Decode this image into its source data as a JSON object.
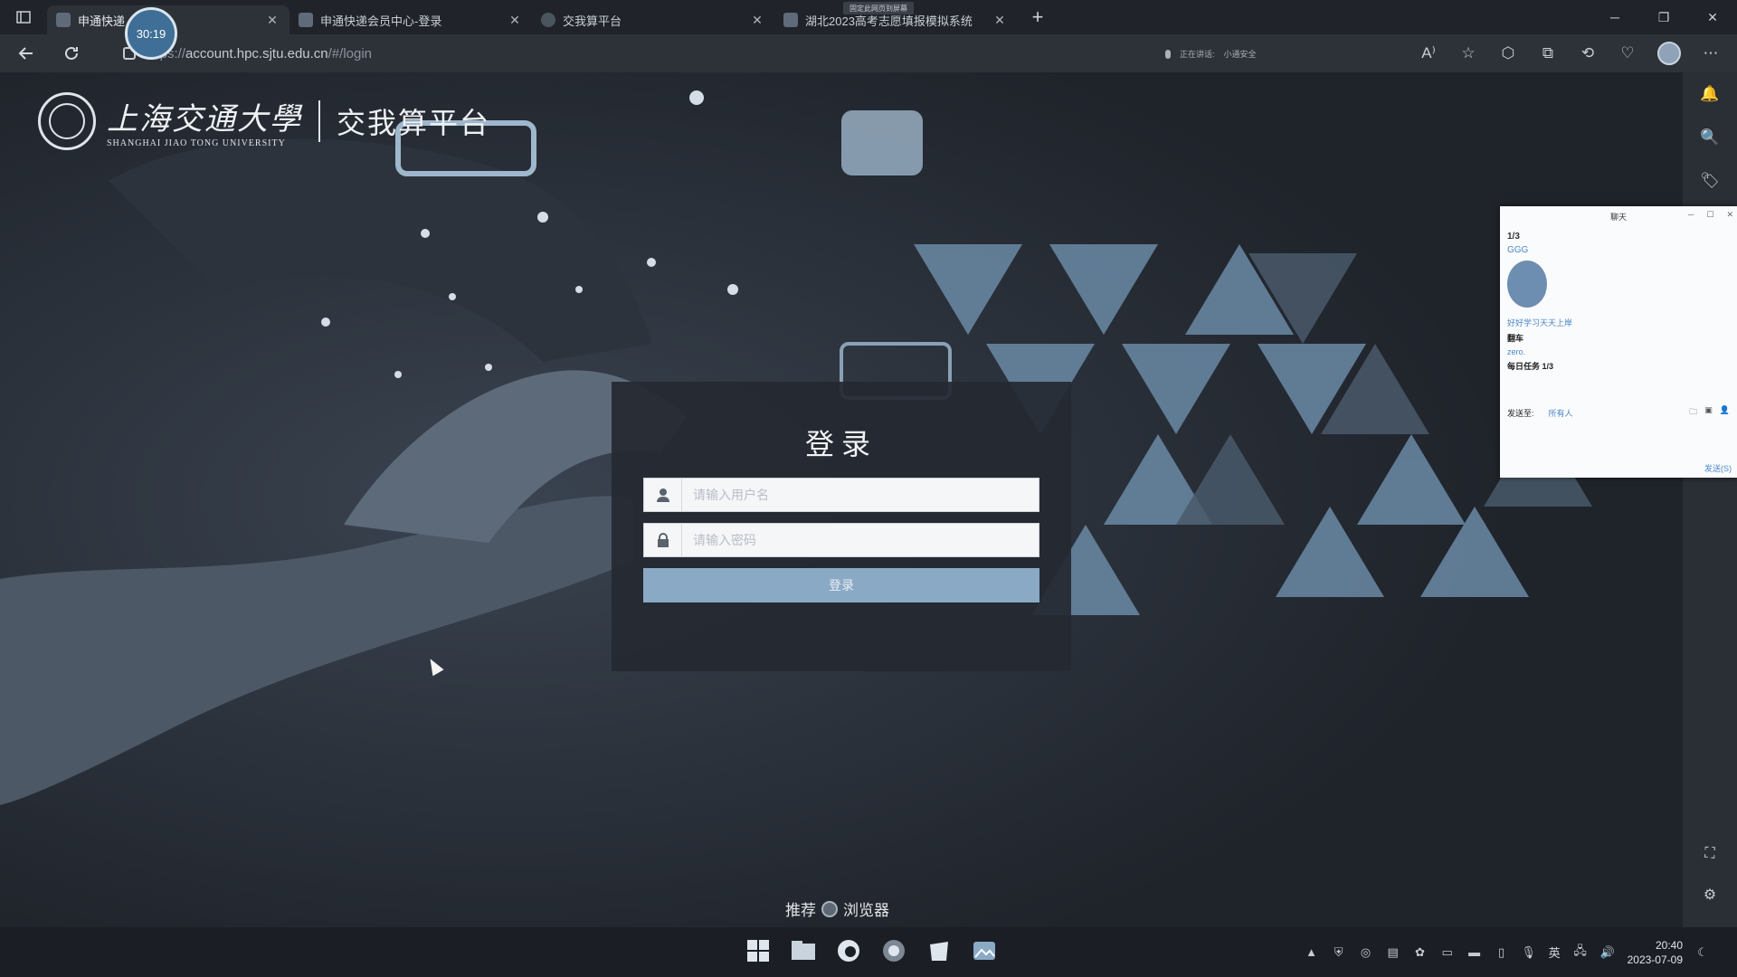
{
  "browser": {
    "tabs": [
      {
        "title": "申通快递",
        "active": true
      },
      {
        "title": "申通快递会员中心-登录",
        "active": false
      },
      {
        "title": "交我算平台",
        "active": false
      },
      {
        "title": "湖北2023高考志愿填报模拟系统",
        "active": false
      }
    ],
    "timer": "30:19",
    "tab_popup": "固定此网页到屏幕",
    "new_tab": "+",
    "url": {
      "protocol": "https://",
      "host": "account.hpc.sjtu.edu.cn",
      "path": "/#/login"
    },
    "listening": {
      "label": "正在讲话:",
      "value": "小通安全"
    }
  },
  "page": {
    "university_cn": "上海交通大學",
    "university_en": "SHANGHAI JIAO TONG UNIVERSITY",
    "platform": "交我算平台",
    "login": {
      "title": "登录",
      "username_placeholder": "请输入用户名",
      "password_placeholder": "请输入密码",
      "submit_label": "登录"
    },
    "recommend": {
      "prefix": "推荐",
      "suffix": "浏览器"
    }
  },
  "chat": {
    "title": "聊天",
    "counter": "1/3",
    "sender": "GGG",
    "messages": [
      "好好学习天天上岸",
      "翻车",
      "zero.",
      "每日任务 1/3"
    ],
    "send_to_label": "发送至:",
    "send_to_value": "所有人",
    "send_label": "发送(S)"
  },
  "taskbar": {
    "ime": "英",
    "time": "20:40",
    "date": "2023-07-09"
  },
  "colors": {
    "accent": "#8aa9c5",
    "panel": "#252931",
    "chrome": "#2d3239"
  }
}
